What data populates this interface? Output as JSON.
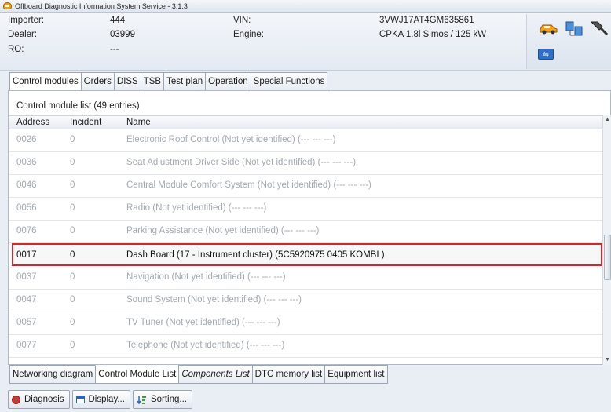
{
  "window": {
    "title": "Offboard Diagnostic Information System Service - 3.1.3"
  },
  "header": {
    "importer_label": "Importer:",
    "importer_value": "444",
    "dealer_label": "Dealer:",
    "dealer_value": "03999",
    "ro_label": "RO:",
    "ro_value": "---",
    "vin_label": "VIN:",
    "vin_value": "3VWJ17AT4GM635861",
    "engine_label": "Engine:",
    "engine_value": "CPKA 1.8l Simos / 125 kW",
    "icons": [
      "car-icon",
      "computer-network-icon",
      "plug-connection-icon",
      "usb-icon"
    ]
  },
  "tabs": [
    "Control modules",
    "Orders",
    "DISS",
    "TSB",
    "Test plan",
    "Operation",
    "Special Functions"
  ],
  "active_tab": "Control modules",
  "list": {
    "title": "Control module list (49 entries)",
    "columns": [
      "Address",
      "Incident",
      "Name"
    ],
    "rows": [
      {
        "address": "0026",
        "incident": "0",
        "name": "Electronic Roof Control (Not yet identified) (---   ---   ---)"
      },
      {
        "address": "0036",
        "incident": "0",
        "name": "Seat Adjustment Driver Side (Not yet identified) (---   ---   ---)"
      },
      {
        "address": "0046",
        "incident": "0",
        "name": "Central Module Comfort System (Not yet identified) (---   ---   ---)"
      },
      {
        "address": "0056",
        "incident": "0",
        "name": "Radio (Not yet identified) (---   ---   ---)"
      },
      {
        "address": "0076",
        "incident": "0",
        "name": "Parking Assistance (Not yet identified) (---   ---   ---)"
      },
      {
        "address": "0017",
        "incident": "0",
        "name": "Dash Board (17 - Instrument cluster) (5C5920975     0405   KOMBI        )",
        "selected": true
      },
      {
        "address": "0037",
        "incident": "0",
        "name": "Navigation (Not yet identified) (---   ---   ---)"
      },
      {
        "address": "0047",
        "incident": "0",
        "name": "Sound System (Not yet identified) (---   ---   ---)"
      },
      {
        "address": "0057",
        "incident": "0",
        "name": "TV Tuner (Not yet identified) (---   ---   ---)"
      },
      {
        "address": "0077",
        "incident": "0",
        "name": "Telephone (Not yet identified) (---   ---   ---)"
      }
    ]
  },
  "subtabs": [
    "Networking diagram",
    "Control Module List",
    "Components List",
    "DTC memory list",
    "Equipment list"
  ],
  "active_subtab": "Control Module List",
  "buttons": {
    "diagnosis": "Diagnosis",
    "display": "Display...",
    "sorting": "Sorting..."
  },
  "colors": {
    "selection_border": "#d4262c",
    "disabled_text": "#a3a9b1"
  }
}
